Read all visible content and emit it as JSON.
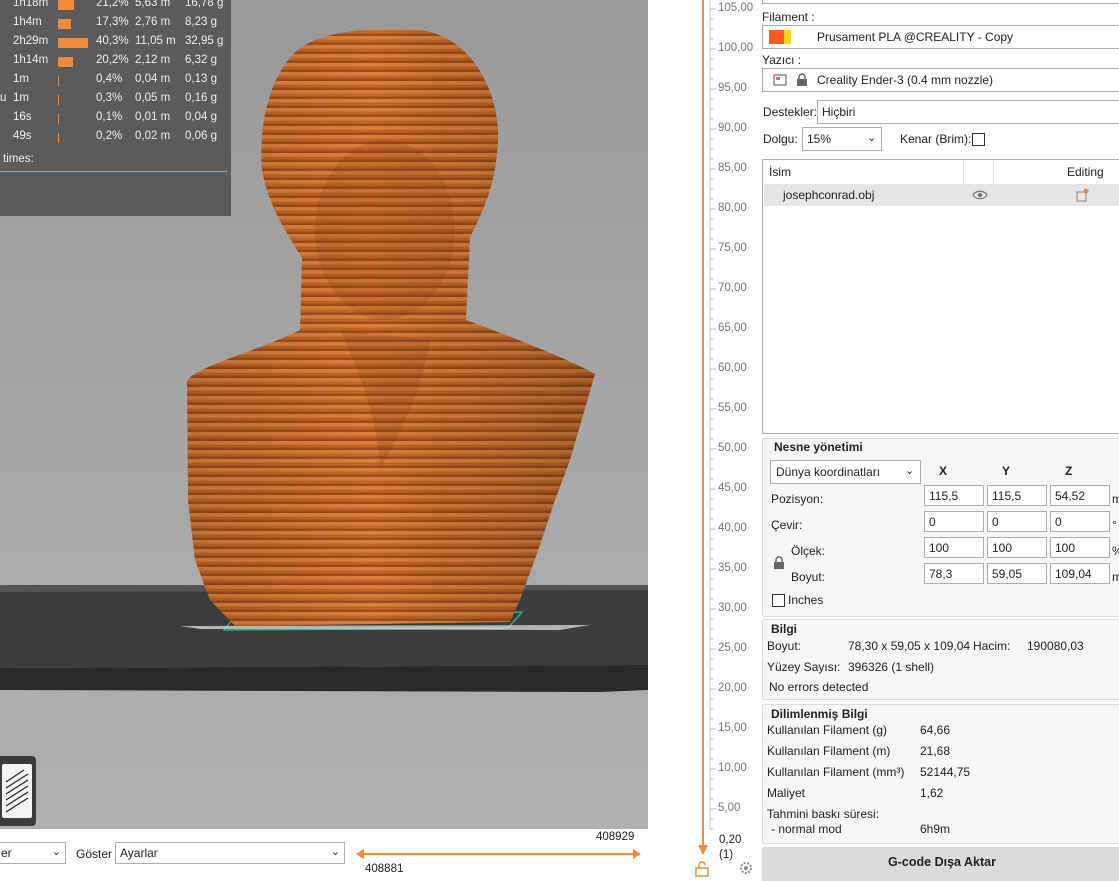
{
  "stats": {
    "rows": [
      {
        "time": "1h18m",
        "pct": "21,2%",
        "len": "5,63 m",
        "wt": "16,78 g",
        "bar": 0.212
      },
      {
        "time": "1h4m",
        "pct": "17,3%",
        "len": "2,76 m",
        "wt": "8,23 g",
        "bar": 0.173
      },
      {
        "time": "2h29m",
        "pct": "40,3%",
        "len": "11,05 m",
        "wt": "32,95 g",
        "bar": 0.403
      },
      {
        "time": "1h14m",
        "pct": "20,2%",
        "len": "2,12 m",
        "wt": "6,32 g",
        "bar": 0.202
      },
      {
        "time": "1m",
        "pct": "0,4%",
        "len": "0,04 m",
        "wt": "0,13 g",
        "bar": 0.004
      },
      {
        "prefix": "u",
        "time": "1m",
        "pct": "0,3%",
        "len": "0,05 m",
        "wt": "0,16 g",
        "bar": 0.003
      },
      {
        "time": "16s",
        "pct": "0,1%",
        "len": "0,01 m",
        "wt": "0,04 g",
        "bar": 0.001
      },
      {
        "time": "49s",
        "pct": "0,2%",
        "len": "0,02 m",
        "wt": "0,06 g",
        "bar": 0.002
      }
    ],
    "times_label": "times:",
    "bar_color": "#ef8a3a"
  },
  "bottom": {
    "view_type": "er",
    "goster_label": "Göster",
    "settings_value": "Ayarlar",
    "h_slider_top": "408929",
    "h_slider_bottom": "408881"
  },
  "vslider": {
    "ticks": [
      "105,00",
      "100,00",
      "95,00",
      "90,00",
      "85,00",
      "80,00",
      "75,00",
      "70,00",
      "65,00",
      "60,00",
      "55,00",
      "50,00",
      "45,00",
      "40,00",
      "35,00",
      "30,00",
      "25,00",
      "20,00",
      "15,00",
      "10,00",
      "5,00"
    ],
    "bottom_value": "0,20",
    "bottom_index": "(1)"
  },
  "panel": {
    "filament_label": "Filament :",
    "filament_value": "Prusament PLA @CREALITY - Copy",
    "printer_label": "Yazıcı :",
    "printer_value": "Creality Ender-3 (0.4 mm nozzle)",
    "supports_label": "Destekler:",
    "supports_value": "Hiçbiri",
    "infill_label": "Dolgu:",
    "infill_value": "15%",
    "brim_label": "Kenar (Brim):",
    "list_col_name": "İsim",
    "list_col_editing": "Editing",
    "object_name": "josephconrad.obj",
    "object_manip": {
      "title": "Nesne yönetimi",
      "coord_system": "Dünya koordinatları",
      "x": "X",
      "y": "Y",
      "z": "Z",
      "position_label": "Pozisyon:",
      "rotation_label": "Çevir:",
      "scale_label": "Ölçek:",
      "size_label": "Boyut:",
      "position": [
        "115,5",
        "115,5",
        "54,52"
      ],
      "rotation": [
        "0",
        "0",
        "0"
      ],
      "scale": [
        "100",
        "100",
        "100"
      ],
      "size": [
        "78,3",
        "59,05",
        "109,04"
      ],
      "unit_pos": "m",
      "unit_rot": "°",
      "unit_scale": "%",
      "unit_size": "m",
      "inches_label": "Inches"
    },
    "info": {
      "title": "Bilgi",
      "size_label": "Boyut:",
      "size_value": "78,30 x 59,05 x 109,04",
      "volume_label": "Hacim:",
      "volume_value": "190080,03",
      "facets_label": "Yüzey Sayısı:",
      "facets_value": "396326 (1 shell)",
      "errors": "No errors detected"
    },
    "sliced": {
      "title": "Dilimlenmiş Bilgi",
      "fil_g_label": "Kullanılan Filament (g)",
      "fil_g": "64,66",
      "fil_m_label": "Kullanılan Filament (m)",
      "fil_m": "21,68",
      "fil_mm3_label": "Kullanılan Filament (mm³)",
      "fil_mm3": "52144,75",
      "cost_label": "Maliyet",
      "cost": "1,62",
      "est_time_label": "Tahmini baskı süresi:",
      "normal_mode_label": "- normal mod",
      "normal_mode": "6h9m"
    },
    "export_button": "G-code Dışa Aktar"
  },
  "colors": {
    "model": "#c8692a",
    "accent": "#ef8a3a",
    "filament_primary": "#ff5a1f",
    "filament_secondary": "#ffd21a"
  }
}
